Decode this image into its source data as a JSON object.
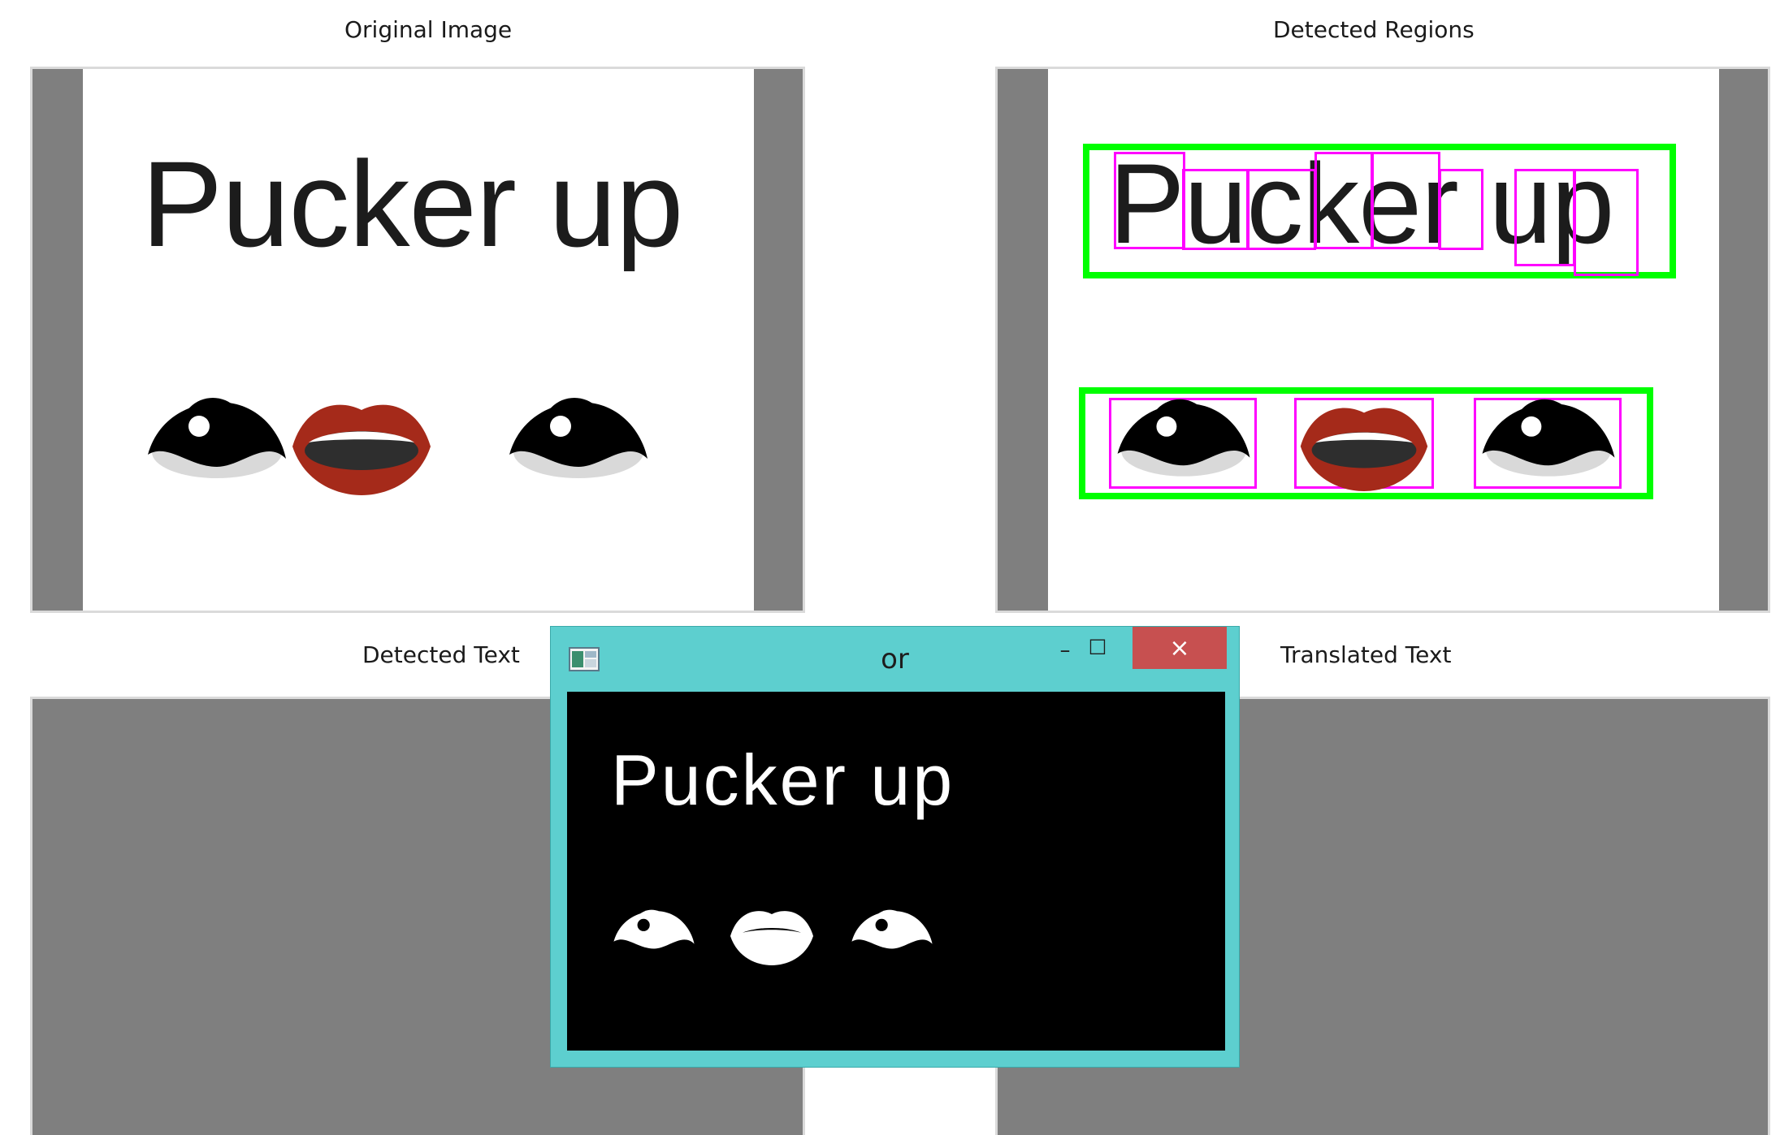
{
  "panels": {
    "original": {
      "title": "Original Image",
      "headline": "Pucker up"
    },
    "regions": {
      "title": "Detected Regions",
      "headline": "Pucker up"
    },
    "detected_text": {
      "title": "Detected Text"
    },
    "translated_text": {
      "title": "Translated Text"
    }
  },
  "window": {
    "title": "or",
    "headline": "Pucker up",
    "minimize_glyph": "–",
    "maximize_glyph": "□",
    "close_glyph": "×"
  },
  "colors": {
    "panel_gray": "#7f7f7f",
    "region_box": "#00ff00",
    "char_box": "#ff00ff",
    "window_frame": "#5dcfcf",
    "close_button": "#c75050"
  },
  "icons": [
    "app-icon",
    "minimize-icon",
    "maximize-icon",
    "close-icon",
    "eye-icon",
    "mouth-icon"
  ]
}
